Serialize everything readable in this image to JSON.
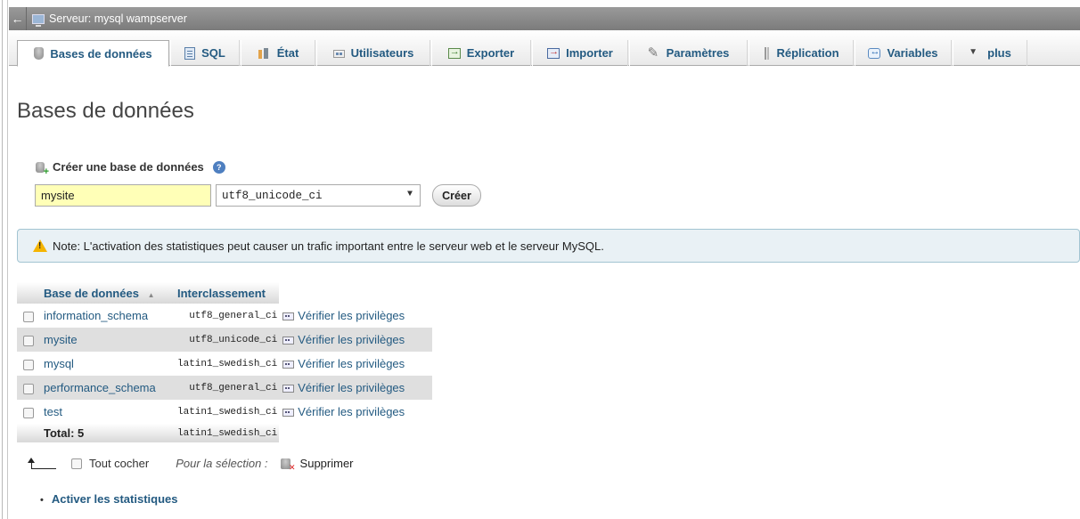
{
  "server_bar": {
    "title": "Serveur: mysql wampserver"
  },
  "tabs": [
    {
      "label": "Bases de données",
      "icon": "database-icon"
    },
    {
      "label": "SQL",
      "icon": "sql-icon"
    },
    {
      "label": "État",
      "icon": "status-icon"
    },
    {
      "label": "Utilisateurs",
      "icon": "users-icon"
    },
    {
      "label": "Exporter",
      "icon": "export-icon"
    },
    {
      "label": "Importer",
      "icon": "import-icon"
    },
    {
      "label": "Paramètres",
      "icon": "wrench-icon"
    },
    {
      "label": "Réplication",
      "icon": "replication-icon"
    },
    {
      "label": "Variables",
      "icon": "variables-icon"
    },
    {
      "label": "plus",
      "icon": "triangle-down-icon"
    }
  ],
  "page_title": "Bases de données",
  "create_db": {
    "label": "Créer une base de données",
    "name_value": "mysite",
    "collation_value": "utf8_unicode_ci",
    "button_label": "Créer"
  },
  "notice": {
    "text": "Note: L'activation des statistiques peut causer un trafic important entre le serveur web et le serveur MySQL."
  },
  "table": {
    "columns": [
      "Base de données",
      "Interclassement"
    ],
    "rows": [
      {
        "name": "information_schema",
        "collation": "utf8_general_ci",
        "privileges": "Vérifier les privilèges"
      },
      {
        "name": "mysite",
        "collation": "utf8_unicode_ci",
        "privileges": "Vérifier les privilèges"
      },
      {
        "name": "mysql",
        "collation": "latin1_swedish_ci",
        "privileges": "Vérifier les privilèges"
      },
      {
        "name": "performance_schema",
        "collation": "utf8_general_ci",
        "privileges": "Vérifier les privilèges"
      },
      {
        "name": "test",
        "collation": "latin1_swedish_ci",
        "privileges": "Vérifier les privilèges"
      }
    ],
    "total_label": "Total: 5",
    "total_collation": "latin1_swedish_ci"
  },
  "selection": {
    "check_all_label": "Tout cocher",
    "for_selection_label": "Pour la sélection :",
    "delete_label": "Supprimer"
  },
  "activate_stats_label": "Activer les statistiques"
}
